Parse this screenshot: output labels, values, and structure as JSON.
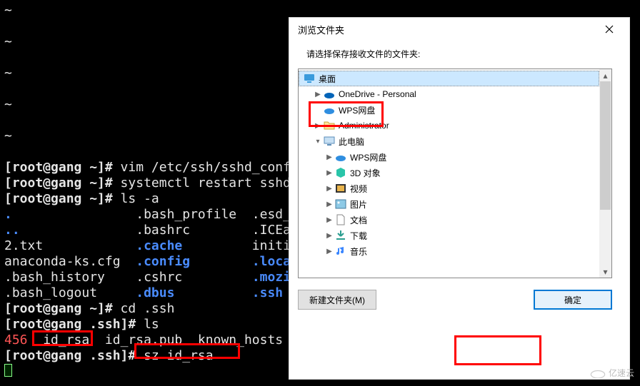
{
  "terminal": {
    "tilde": "~",
    "line1_user": "[root@gang ~]#",
    "line1_cmd": " vim /etc/ssh/sshd_config",
    "line2_user": "[root@gang ~]#",
    "line2_cmd": " systemctl restart sshd",
    "line3_user": "[root@gang ~]#",
    "line3_cmd": " ls -a",
    "col": {
      "dot": ".",
      "dotdot": "..",
      "txt": "2.txt",
      "ana": "anaconda-ks.cfg",
      "bh": ".bash_history",
      "bl": ".bash_logout",
      "bp": ".bash_profile",
      "brc": ".bashrc",
      "cache": ".cache",
      "config": ".config",
      "cshrc": ".cshrc",
      "dbus": ".dbus",
      "esd": ".esd_auth",
      "ice": ".ICEauthority",
      "ini": "initial-setup-ks.cfg",
      "local": ".local",
      "mozilla": ".mozilla",
      "ssh": ".ssh"
    },
    "line_cd_user": "[root@gang ~]#",
    "line_cd_cmd": " cd .ssh",
    "line_ls_user": "[root@gang .ssh]#",
    "line_ls_cmd": " ls",
    "ls_out_pfx": "456  ",
    "ls_out_a": "id_rsa",
    "ls_out_b": "  id_rsa.pub  known_hosts",
    "line_sz_user": "[root@gang .ssh]#",
    "line_sz_cmd": " sz id_rsa"
  },
  "dialog": {
    "title": "浏览文件夹",
    "prompt": "请选择保存接收文件的文件夹:",
    "tree": {
      "i0": "桌面",
      "i1": "OneDrive - Personal",
      "i2": "WPS网盘",
      "i3": "Administrator",
      "i4": "此电脑",
      "i5": "WPS网盘",
      "i6": "3D 对象",
      "i7": "视频",
      "i8": "图片",
      "i9": "文档",
      "i10": "下载",
      "i11": "音乐"
    },
    "btn_new": "新建文件夹(M)",
    "btn_ok": "确定",
    "new_hotkey": "M"
  },
  "watermark": "亿速云",
  "colors": {
    "highlight": "#f00",
    "tree_sel": "#cce8ff",
    "accent": "#0078d4"
  }
}
